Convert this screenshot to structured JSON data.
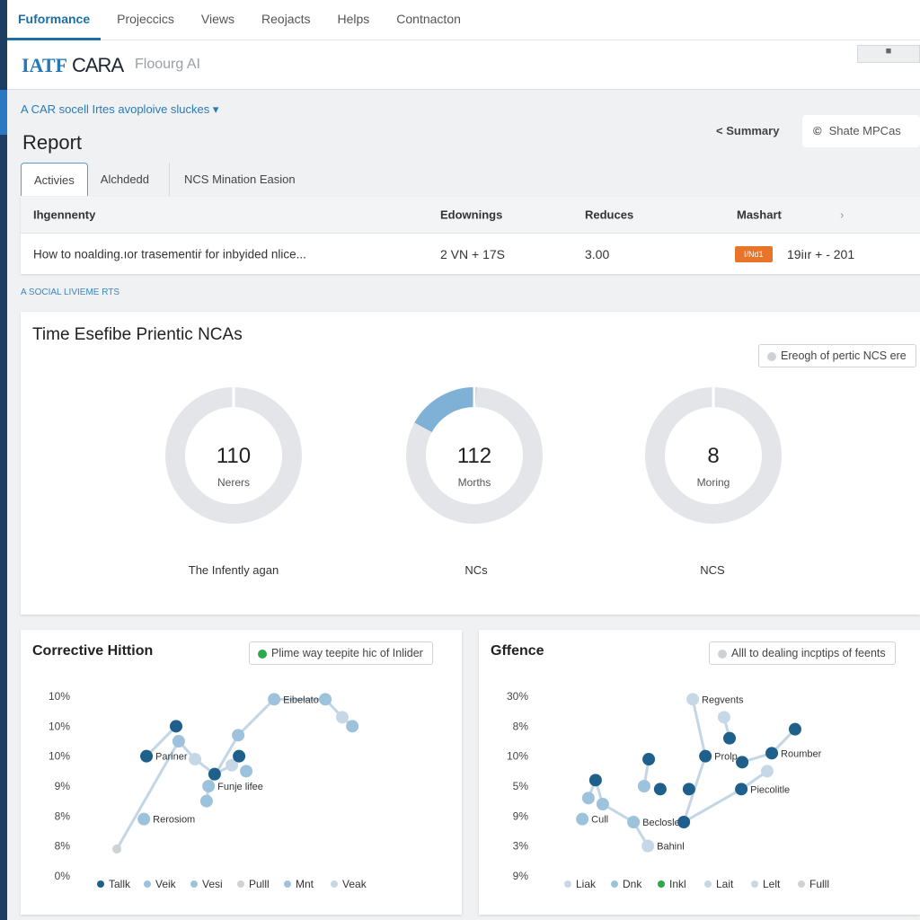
{
  "nav": {
    "tabs": [
      "Fuformance",
      "Projeccics",
      "Views",
      "Reojacts",
      "Helps",
      "Contnacton"
    ],
    "active": 0
  },
  "header": {
    "logo_a": "IATF",
    "logo_b": "CARA",
    "subtitle": "Floourg  AI",
    "button_icon": "toggle-icon"
  },
  "breadcrumb": "A CAR socell Irtes avoploive sluckes ▾",
  "page_title": "Report",
  "summary_link": "<  Summary",
  "share_button": {
    "icon": "copyright-icon",
    "label": "Shate MPCas"
  },
  "tabs": [
    "Activies",
    "Alchdedd",
    "NCS Mination Easion"
  ],
  "table": {
    "headers": [
      "Ihgennenty",
      "Edownings",
      "Reduces",
      "Mashart"
    ],
    "header_chevron": "›",
    "rows": [
      {
        "title": "How to noalding.ıor trasementiṙ for inbyided nlice...",
        "edownings": "2 VN + 17S",
        "reduces": "3.00",
        "badge": "I/Nd1",
        "mashart": "19iır + - 201"
      }
    ]
  },
  "section_label": "A SOCIAL LIVIEME RTS",
  "donut_card": {
    "title": "Time Esefibe Prientic NCAs",
    "pill": "Ereogh of pertic NCS ere",
    "donuts": [
      {
        "value": "110",
        "unit": "Nerers",
        "caption": "The Infently agan",
        "fill": 0
      },
      {
        "value": "112",
        "unit": "Morths",
        "caption": "NCs",
        "fill": 0.17
      },
      {
        "value": "8",
        "unit": "Moring",
        "caption": "NCS",
        "fill": 0
      }
    ]
  },
  "colors": {
    "dark": "#1f5f8b",
    "light": "#9dc2dc",
    "pale": "#c6d8e6",
    "gray": "#cfd2d5",
    "green": "#2ea84a",
    "accent": "#1c6ea8",
    "badge": "#e8742a"
  },
  "chart_data": [
    {
      "type": "scatter",
      "title": "Corrective Hittion",
      "pill": "Plime way teepite hic of Inlider",
      "pill_color": "green",
      "yticks": [
        "10%",
        "10%",
        "10%",
        "9%",
        "8%",
        "8%",
        "0%"
      ],
      "legend": [
        {
          "name": "Tallk",
          "c": "dark"
        },
        {
          "name": "Veik",
          "c": "light"
        },
        {
          "name": "Vesi",
          "c": "light"
        },
        {
          "name": "Pulll",
          "c": "gray"
        },
        {
          "name": "Mnt",
          "c": "light"
        },
        {
          "name": "Veak",
          "c": "pale"
        }
      ],
      "points": [
        [
          9.4,
          0.9,
          "gray"
        ],
        [
          18.8,
          1.9,
          "light",
          "Rerosiom"
        ],
        [
          19.7,
          4.0,
          "dark",
          "Pariner"
        ],
        [
          30,
          5.0,
          "dark"
        ],
        [
          30.9,
          4.5,
          "light"
        ],
        [
          36.6,
          3.9,
          "pale"
        ],
        [
          43.4,
          3.4,
          "dark"
        ],
        [
          40.6,
          2.5,
          "light"
        ],
        [
          41.3,
          3.0,
          "light",
          "Funje lifee"
        ],
        [
          49.4,
          3.7,
          "pale"
        ],
        [
          51.9,
          4.0,
          "dark"
        ],
        [
          54.4,
          3.5,
          "light"
        ],
        [
          51.6,
          4.7,
          "light"
        ],
        [
          64.1,
          5.9,
          "light",
          "Eibelato"
        ],
        [
          81.9,
          5.9,
          "light"
        ],
        [
          87.8,
          5.3,
          "pale"
        ],
        [
          91.3,
          5.0,
          "light"
        ]
      ],
      "lines": [
        [
          0,
          4,
          5,
          6,
          9,
          10
        ],
        [
          7,
          8,
          12,
          13,
          14,
          15,
          16
        ],
        [
          2,
          3
        ]
      ]
    },
    {
      "type": "scatter",
      "title": "Gffence",
      "pill": "Alll to dealing incptips of feents",
      "pill_color": "gray",
      "yticks": [
        "30%",
        "8%",
        "10%",
        "5%",
        "9%",
        "3%",
        "9%"
      ],
      "legend": [
        {
          "name": "Liak",
          "c": "pale"
        },
        {
          "name": "Dnk",
          "c": "light"
        },
        {
          "name": "Inkl",
          "c": "green"
        },
        {
          "name": "Lait",
          "c": "pale"
        },
        {
          "name": "Lelt",
          "c": "pale"
        },
        {
          "name": "Fulll",
          "c": "gray"
        }
      ],
      "points": [
        [
          8.8,
          1.9,
          "light",
          "Cull"
        ],
        [
          10.9,
          2.6,
          "light"
        ],
        [
          13.4,
          3.2,
          "dark"
        ],
        [
          15.9,
          2.4,
          "light"
        ],
        [
          26.6,
          1.8,
          "light",
          "Beclosle"
        ],
        [
          30.3,
          3.0,
          "light"
        ],
        [
          31.9,
          3.9,
          "dark"
        ],
        [
          35.9,
          2.9,
          "dark"
        ],
        [
          31.6,
          1.0,
          "pale",
          "Bahinl"
        ],
        [
          44.1,
          1.8,
          "dark"
        ],
        [
          45.9,
          2.9,
          "dark"
        ],
        [
          47.2,
          5.9,
          "pale",
          "Regvents"
        ],
        [
          51.6,
          4.0,
          "dark",
          "Prolp"
        ],
        [
          58.1,
          5.3,
          "pale"
        ],
        [
          60,
          4.6,
          "dark"
        ],
        [
          64.4,
          3.8,
          "dark"
        ],
        [
          64.1,
          2.9,
          "dark",
          "Piecolitle"
        ],
        [
          73.1,
          3.5,
          "pale"
        ],
        [
          74.7,
          4.1,
          "dark",
          "Roumber"
        ],
        [
          82.8,
          4.9,
          "dark"
        ]
      ],
      "lines": [
        [
          1,
          2,
          3,
          4,
          8
        ],
        [
          5,
          6
        ],
        [
          11,
          12,
          9,
          16,
          17
        ],
        [
          13,
          14
        ],
        [
          15,
          18,
          19
        ]
      ]
    }
  ]
}
